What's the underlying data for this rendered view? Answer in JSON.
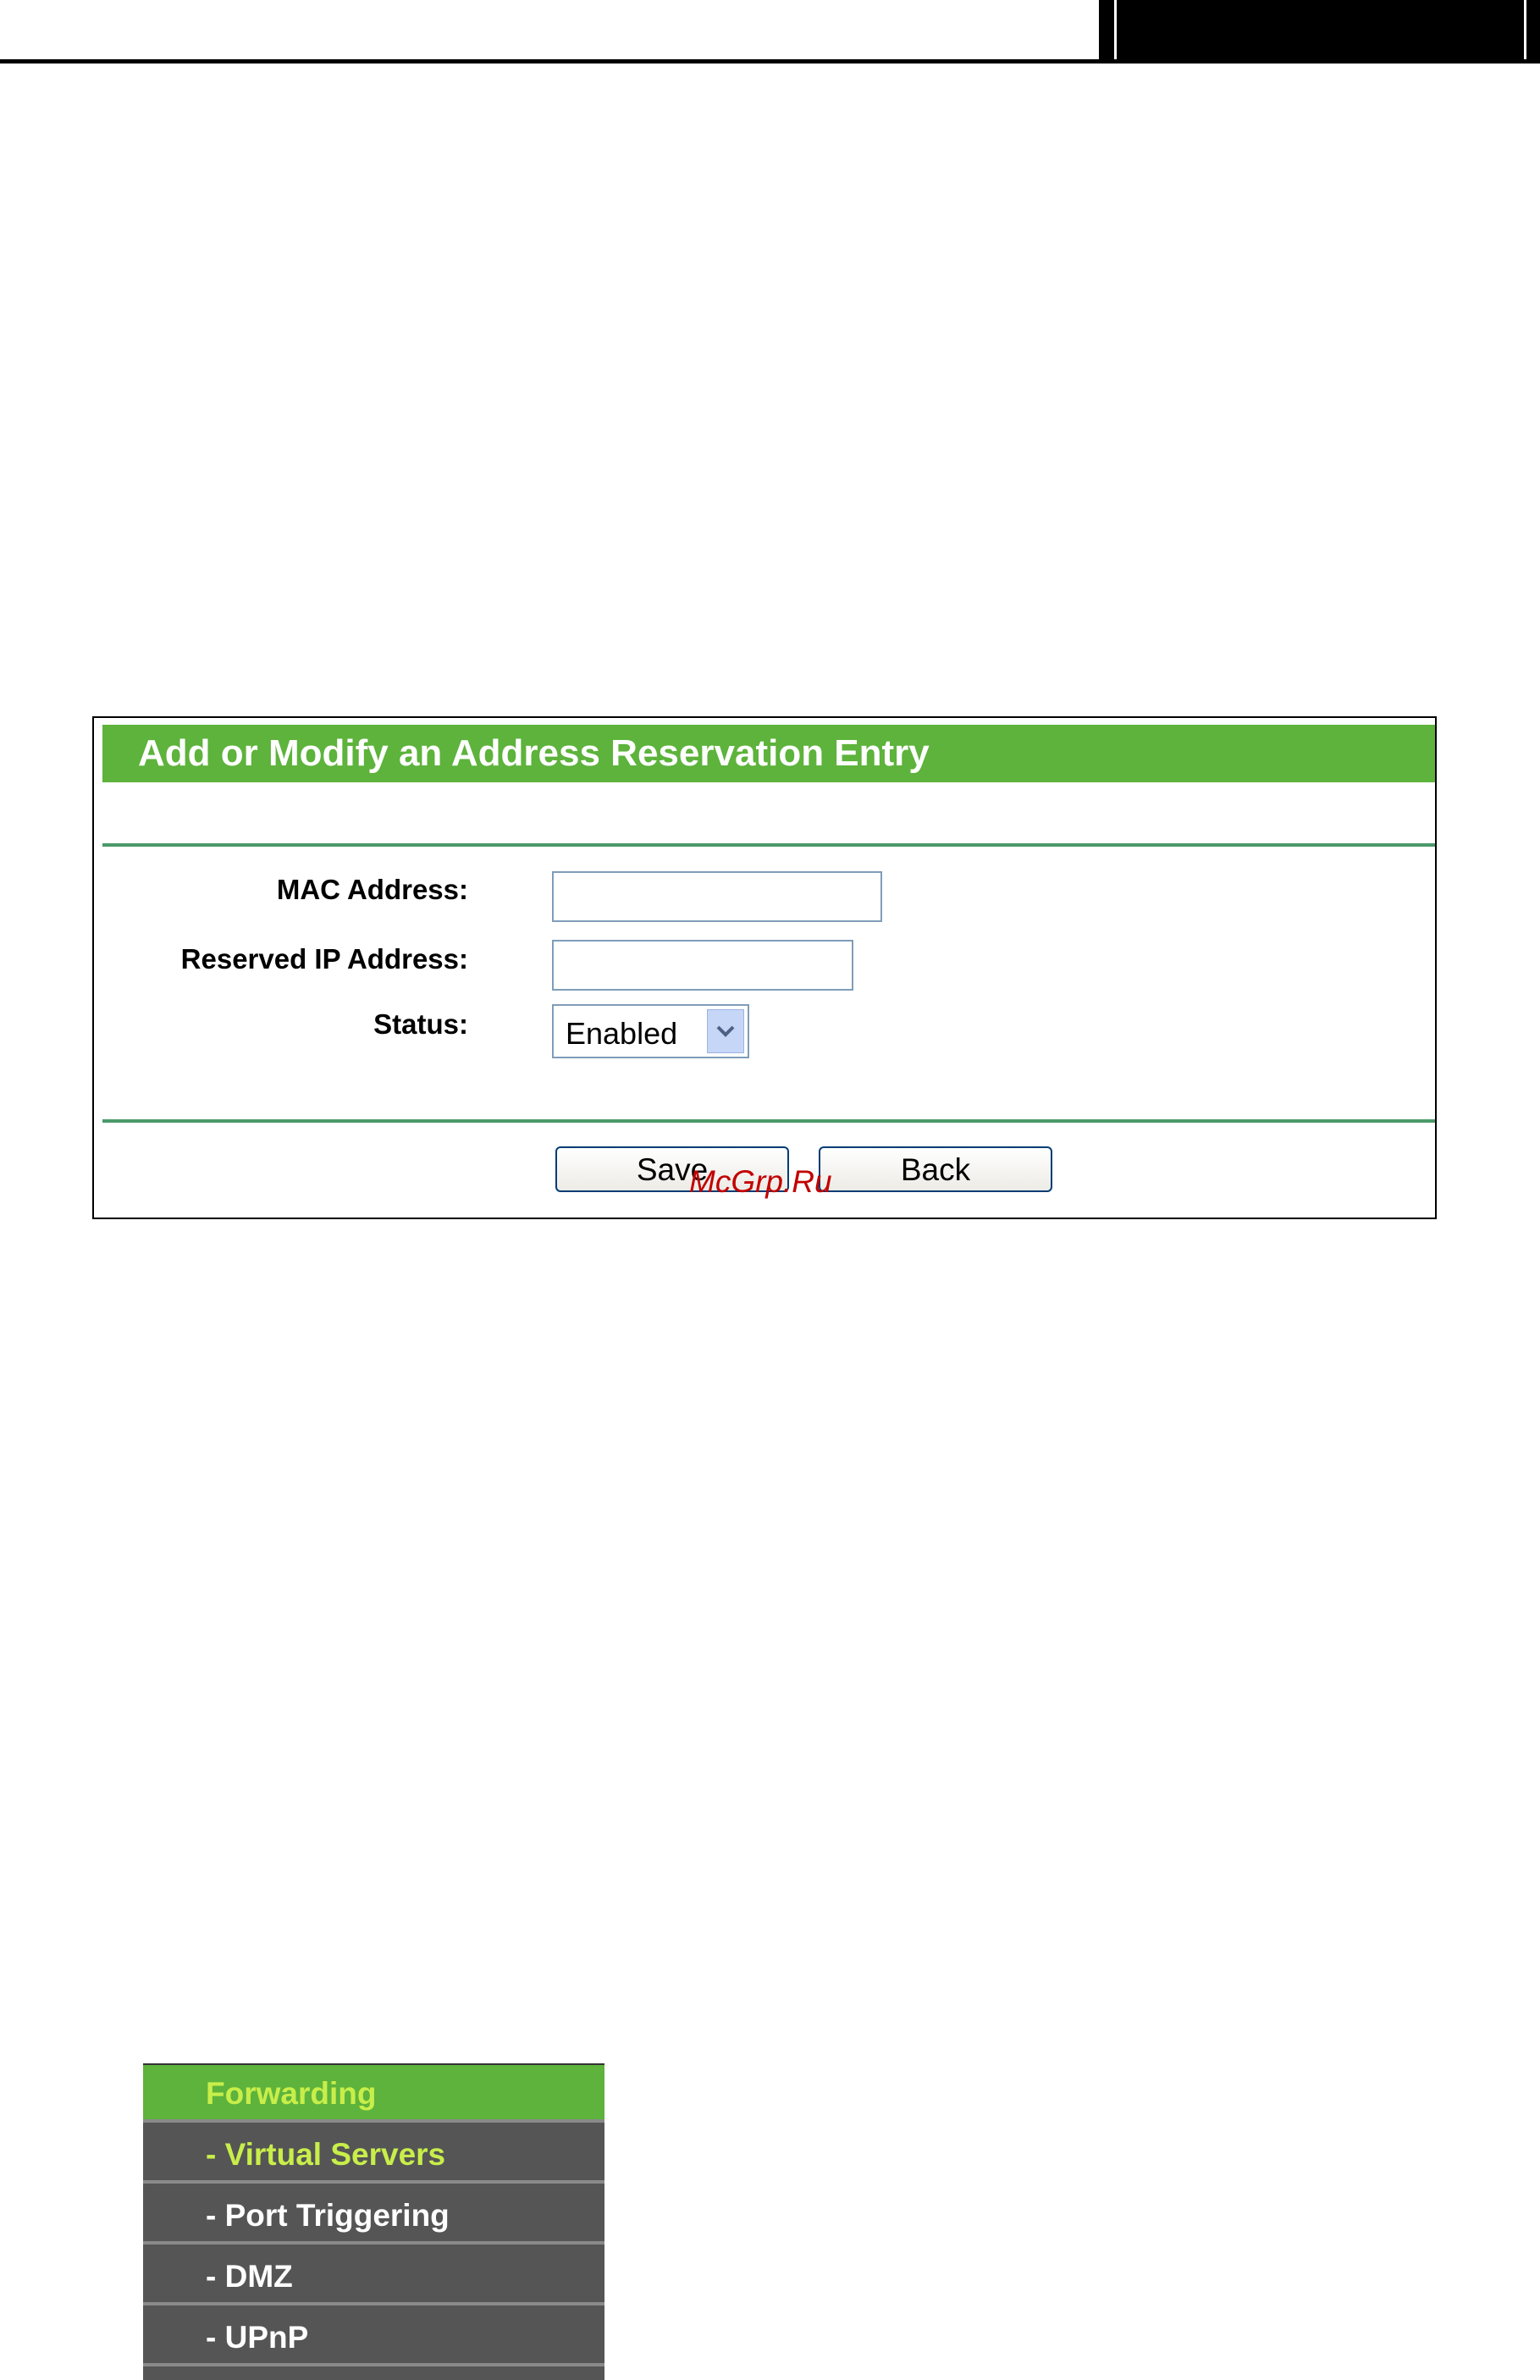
{
  "form": {
    "title": "Add or Modify an Address Reservation Entry",
    "mac_label": "MAC Address:",
    "mac_value": "",
    "ip_label": "Reserved IP Address:",
    "ip_value": "",
    "status_label": "Status:",
    "status_value": "Enabled",
    "save_label": "Save",
    "back_label": "Back",
    "accent_color": "#5db33b"
  },
  "watermark": "McGrp.Ru",
  "menu": {
    "header": "Forwarding",
    "items": [
      {
        "label": "- Virtual Servers"
      },
      {
        "label": "- Port Triggering"
      },
      {
        "label": "- DMZ"
      },
      {
        "label": "- UPnP"
      }
    ]
  }
}
